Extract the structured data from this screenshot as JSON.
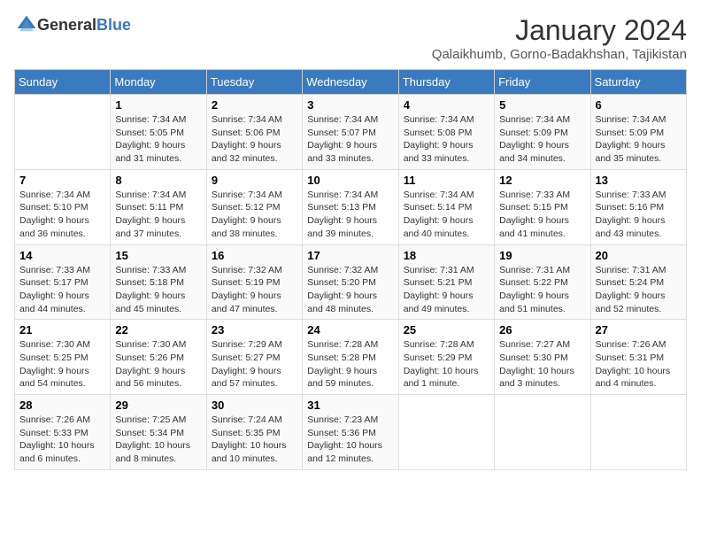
{
  "header": {
    "logo_general": "General",
    "logo_blue": "Blue",
    "month": "January 2024",
    "location": "Qalaikhumb, Gorno-Badakhshan, Tajikistan"
  },
  "weekdays": [
    "Sunday",
    "Monday",
    "Tuesday",
    "Wednesday",
    "Thursday",
    "Friday",
    "Saturday"
  ],
  "weeks": [
    [
      {
        "day": "",
        "sunrise": "",
        "sunset": "",
        "daylight": ""
      },
      {
        "day": "1",
        "sunrise": "7:34 AM",
        "sunset": "5:05 PM",
        "daylight": "9 hours and 31 minutes."
      },
      {
        "day": "2",
        "sunrise": "7:34 AM",
        "sunset": "5:06 PM",
        "daylight": "9 hours and 32 minutes."
      },
      {
        "day": "3",
        "sunrise": "7:34 AM",
        "sunset": "5:07 PM",
        "daylight": "9 hours and 33 minutes."
      },
      {
        "day": "4",
        "sunrise": "7:34 AM",
        "sunset": "5:08 PM",
        "daylight": "9 hours and 33 minutes."
      },
      {
        "day": "5",
        "sunrise": "7:34 AM",
        "sunset": "5:09 PM",
        "daylight": "9 hours and 34 minutes."
      },
      {
        "day": "6",
        "sunrise": "7:34 AM",
        "sunset": "5:09 PM",
        "daylight": "9 hours and 35 minutes."
      }
    ],
    [
      {
        "day": "7",
        "sunrise": "7:34 AM",
        "sunset": "5:10 PM",
        "daylight": "9 hours and 36 minutes."
      },
      {
        "day": "8",
        "sunrise": "7:34 AM",
        "sunset": "5:11 PM",
        "daylight": "9 hours and 37 minutes."
      },
      {
        "day": "9",
        "sunrise": "7:34 AM",
        "sunset": "5:12 PM",
        "daylight": "9 hours and 38 minutes."
      },
      {
        "day": "10",
        "sunrise": "7:34 AM",
        "sunset": "5:13 PM",
        "daylight": "9 hours and 39 minutes."
      },
      {
        "day": "11",
        "sunrise": "7:34 AM",
        "sunset": "5:14 PM",
        "daylight": "9 hours and 40 minutes."
      },
      {
        "day": "12",
        "sunrise": "7:33 AM",
        "sunset": "5:15 PM",
        "daylight": "9 hours and 41 minutes."
      },
      {
        "day": "13",
        "sunrise": "7:33 AM",
        "sunset": "5:16 PM",
        "daylight": "9 hours and 43 minutes."
      }
    ],
    [
      {
        "day": "14",
        "sunrise": "7:33 AM",
        "sunset": "5:17 PM",
        "daylight": "9 hours and 44 minutes."
      },
      {
        "day": "15",
        "sunrise": "7:33 AM",
        "sunset": "5:18 PM",
        "daylight": "9 hours and 45 minutes."
      },
      {
        "day": "16",
        "sunrise": "7:32 AM",
        "sunset": "5:19 PM",
        "daylight": "9 hours and 47 minutes."
      },
      {
        "day": "17",
        "sunrise": "7:32 AM",
        "sunset": "5:20 PM",
        "daylight": "9 hours and 48 minutes."
      },
      {
        "day": "18",
        "sunrise": "7:31 AM",
        "sunset": "5:21 PM",
        "daylight": "9 hours and 49 minutes."
      },
      {
        "day": "19",
        "sunrise": "7:31 AM",
        "sunset": "5:22 PM",
        "daylight": "9 hours and 51 minutes."
      },
      {
        "day": "20",
        "sunrise": "7:31 AM",
        "sunset": "5:24 PM",
        "daylight": "9 hours and 52 minutes."
      }
    ],
    [
      {
        "day": "21",
        "sunrise": "7:30 AM",
        "sunset": "5:25 PM",
        "daylight": "9 hours and 54 minutes."
      },
      {
        "day": "22",
        "sunrise": "7:30 AM",
        "sunset": "5:26 PM",
        "daylight": "9 hours and 56 minutes."
      },
      {
        "day": "23",
        "sunrise": "7:29 AM",
        "sunset": "5:27 PM",
        "daylight": "9 hours and 57 minutes."
      },
      {
        "day": "24",
        "sunrise": "7:28 AM",
        "sunset": "5:28 PM",
        "daylight": "9 hours and 59 minutes."
      },
      {
        "day": "25",
        "sunrise": "7:28 AM",
        "sunset": "5:29 PM",
        "daylight": "10 hours and 1 minute."
      },
      {
        "day": "26",
        "sunrise": "7:27 AM",
        "sunset": "5:30 PM",
        "daylight": "10 hours and 3 minutes."
      },
      {
        "day": "27",
        "sunrise": "7:26 AM",
        "sunset": "5:31 PM",
        "daylight": "10 hours and 4 minutes."
      }
    ],
    [
      {
        "day": "28",
        "sunrise": "7:26 AM",
        "sunset": "5:33 PM",
        "daylight": "10 hours and 6 minutes."
      },
      {
        "day": "29",
        "sunrise": "7:25 AM",
        "sunset": "5:34 PM",
        "daylight": "10 hours and 8 minutes."
      },
      {
        "day": "30",
        "sunrise": "7:24 AM",
        "sunset": "5:35 PM",
        "daylight": "10 hours and 10 minutes."
      },
      {
        "day": "31",
        "sunrise": "7:23 AM",
        "sunset": "5:36 PM",
        "daylight": "10 hours and 12 minutes."
      },
      {
        "day": "",
        "sunrise": "",
        "sunset": "",
        "daylight": ""
      },
      {
        "day": "",
        "sunrise": "",
        "sunset": "",
        "daylight": ""
      },
      {
        "day": "",
        "sunrise": "",
        "sunset": "",
        "daylight": ""
      }
    ]
  ],
  "labels": {
    "sunrise": "Sunrise:",
    "sunset": "Sunset:",
    "daylight": "Daylight:"
  }
}
